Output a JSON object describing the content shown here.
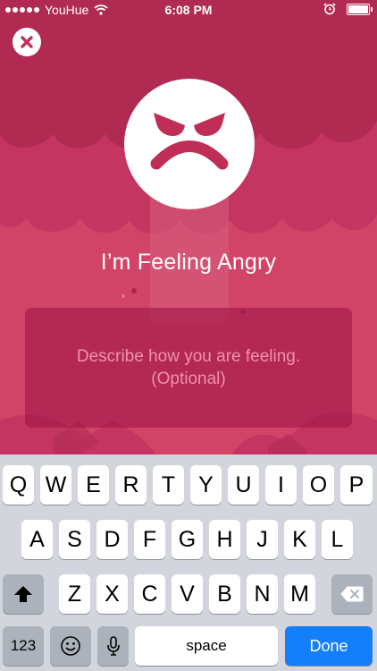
{
  "status_bar": {
    "carrier": "YouHue",
    "time": "6:08 PM"
  },
  "mood": {
    "title": "I’m Feeling Angry",
    "description_line1": "Describe how you are feeling.",
    "description_line2": "(Optional)"
  },
  "keyboard": {
    "row1": [
      "Q",
      "W",
      "E",
      "R",
      "T",
      "Y",
      "U",
      "I",
      "O",
      "P"
    ],
    "row2": [
      "A",
      "S",
      "D",
      "F",
      "G",
      "H",
      "J",
      "K",
      "L"
    ],
    "row3": [
      "Z",
      "X",
      "C",
      "V",
      "B",
      "N",
      "M"
    ],
    "numbers_key": "123",
    "space_key": "space",
    "done_key": "Done"
  },
  "colors": {
    "background": "#c1305a",
    "accent": "#147efb",
    "placeholder": "#f291ad"
  },
  "icons": {
    "close": "close-icon",
    "face": "angry-face-icon",
    "shift": "shift-icon",
    "delete": "backspace-icon",
    "emoji": "emoji-icon",
    "mic": "microphone-icon"
  }
}
